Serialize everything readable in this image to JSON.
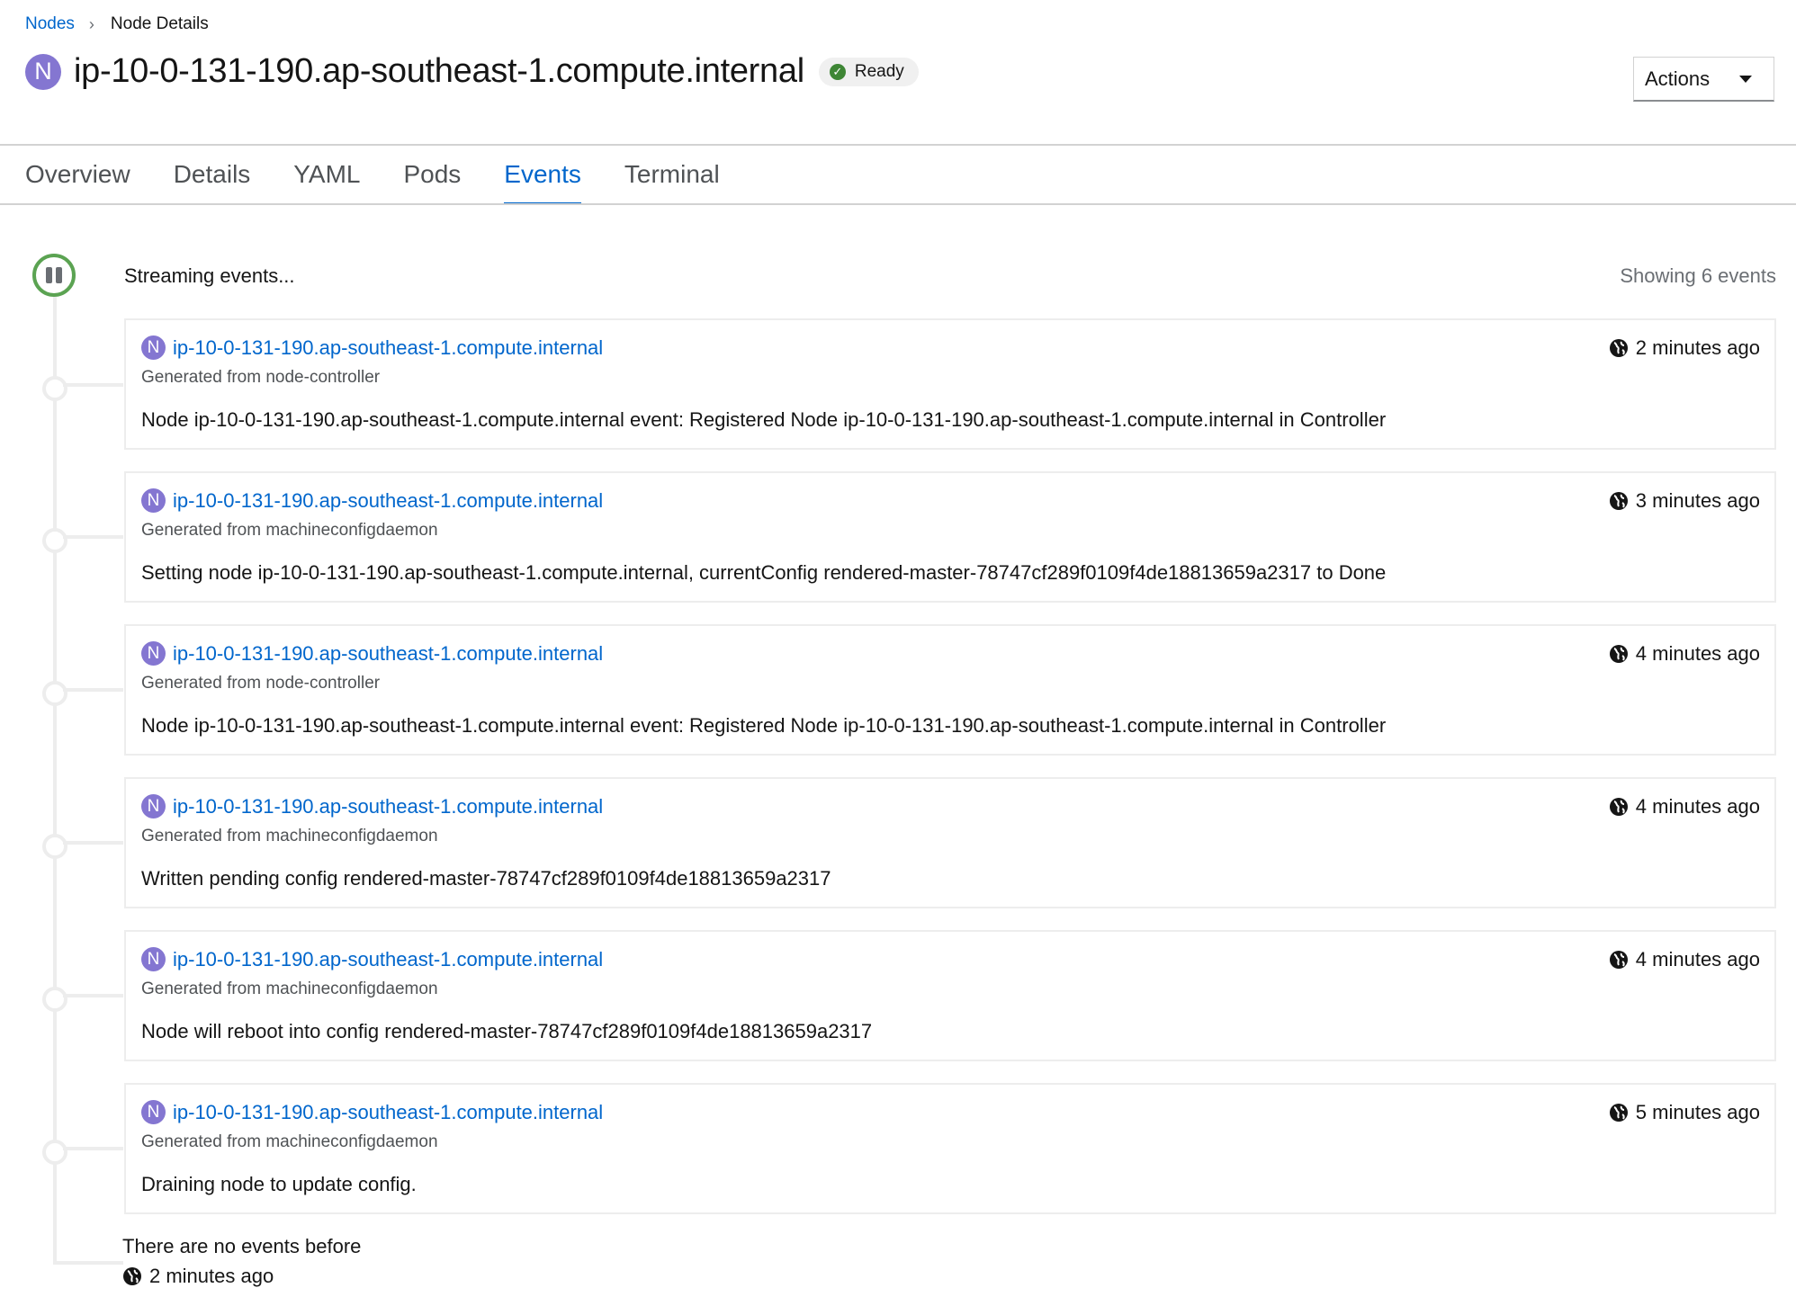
{
  "breadcrumb": {
    "parent": "Nodes",
    "current": "Node Details"
  },
  "header": {
    "badge": "N",
    "title": "ip-10-0-131-190.ap-southeast-1.compute.internal",
    "status": "Ready",
    "actions_label": "Actions"
  },
  "tabs": [
    "Overview",
    "Details",
    "YAML",
    "Pods",
    "Events",
    "Terminal"
  ],
  "active_tab": "Events",
  "events_panel": {
    "streaming_text": "Streaming events...",
    "showing_text": "Showing 6 events",
    "events": [
      {
        "badge": "N",
        "name": "ip-10-0-131-190.ap-southeast-1.compute.internal",
        "source": "Generated from node-controller",
        "message": "Node ip-10-0-131-190.ap-southeast-1.compute.internal event: Registered Node ip-10-0-131-190.ap-southeast-1.compute.internal in Controller",
        "time": "2 minutes ago"
      },
      {
        "badge": "N",
        "name": "ip-10-0-131-190.ap-southeast-1.compute.internal",
        "source": "Generated from machineconfigdaemon",
        "message": "Setting node ip-10-0-131-190.ap-southeast-1.compute.internal, currentConfig rendered-master-78747cf289f0109f4de18813659a2317 to Done",
        "time": "3 minutes ago"
      },
      {
        "badge": "N",
        "name": "ip-10-0-131-190.ap-southeast-1.compute.internal",
        "source": "Generated from node-controller",
        "message": "Node ip-10-0-131-190.ap-southeast-1.compute.internal event: Registered Node ip-10-0-131-190.ap-southeast-1.compute.internal in Controller",
        "time": "4 minutes ago"
      },
      {
        "badge": "N",
        "name": "ip-10-0-131-190.ap-southeast-1.compute.internal",
        "source": "Generated from machineconfigdaemon",
        "message": "Written pending config rendered-master-78747cf289f0109f4de18813659a2317",
        "time": "4 minutes ago"
      },
      {
        "badge": "N",
        "name": "ip-10-0-131-190.ap-southeast-1.compute.internal",
        "source": "Generated from machineconfigdaemon",
        "message": "Node will reboot into config rendered-master-78747cf289f0109f4de18813659a2317",
        "time": "4 minutes ago"
      },
      {
        "badge": "N",
        "name": "ip-10-0-131-190.ap-southeast-1.compute.internal",
        "source": "Generated from machineconfigdaemon",
        "message": "Draining node to update config.",
        "time": "5 minutes ago"
      }
    ],
    "footer_text": "There are no events before",
    "footer_time": "2 minutes ago"
  },
  "colors": {
    "link": "#0066cc",
    "node_badge": "#8476d1",
    "ready_check": "#3e8635",
    "streaming_ring": "#5ba352"
  },
  "icons": {
    "event_time": "globe-icon",
    "status": "check-circle-icon",
    "stream_toggle": "pause-icon"
  }
}
